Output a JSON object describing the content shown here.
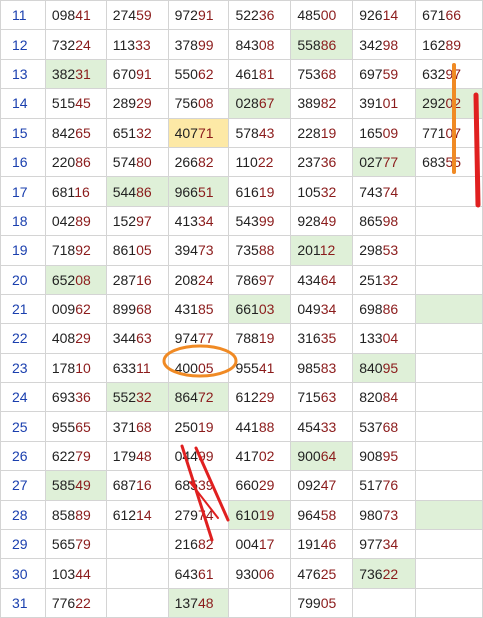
{
  "rows": [
    {
      "num": "11",
      "cells": [
        {
          "v": "09841"
        },
        {
          "v": "27459"
        },
        {
          "v": "97291"
        },
        {
          "v": "52236"
        },
        {
          "v": "48500"
        },
        {
          "v": "92614"
        },
        {
          "v": "67166"
        }
      ]
    },
    {
      "num": "12",
      "cells": [
        {
          "v": "73224"
        },
        {
          "v": "11333"
        },
        {
          "v": "37899"
        },
        {
          "v": "84308"
        },
        {
          "v": "55886",
          "hl": "green"
        },
        {
          "v": "34298"
        },
        {
          "v": "16289"
        }
      ]
    },
    {
      "num": "13",
      "cells": [
        {
          "v": "38231",
          "hl": "green"
        },
        {
          "v": "67091"
        },
        {
          "v": "55062"
        },
        {
          "v": "46181"
        },
        {
          "v": "75368"
        },
        {
          "v": "69759"
        },
        {
          "v": "63297"
        }
      ]
    },
    {
      "num": "14",
      "cells": [
        {
          "v": "51545"
        },
        {
          "v": "28929"
        },
        {
          "v": "75608"
        },
        {
          "v": "02867",
          "hl": "green"
        },
        {
          "v": "38982"
        },
        {
          "v": "39101"
        },
        {
          "v": "29202",
          "hl": "green"
        }
      ]
    },
    {
      "num": "15",
      "cells": [
        {
          "v": "84265"
        },
        {
          "v": "65132"
        },
        {
          "v": "40771",
          "hl": "yellow"
        },
        {
          "v": "57843"
        },
        {
          "v": "22819"
        },
        {
          "v": "16509"
        },
        {
          "v": "77107"
        }
      ]
    },
    {
      "num": "16",
      "cells": [
        {
          "v": "22086"
        },
        {
          "v": "57480"
        },
        {
          "v": "26682"
        },
        {
          "v": "11022"
        },
        {
          "v": "23736"
        },
        {
          "v": "02777",
          "hl": "green"
        },
        {
          "v": "68355"
        }
      ]
    },
    {
      "num": "17",
      "cells": [
        {
          "v": "68116"
        },
        {
          "v": "54486",
          "hl": "green"
        },
        {
          "v": "96651",
          "hl": "green"
        },
        {
          "v": "61619"
        },
        {
          "v": "10532"
        },
        {
          "v": "74374"
        },
        {
          "v": ""
        }
      ]
    },
    {
      "num": "18",
      "cells": [
        {
          "v": "04289"
        },
        {
          "v": "15297"
        },
        {
          "v": "41334"
        },
        {
          "v": "54399"
        },
        {
          "v": "92849"
        },
        {
          "v": "86598"
        },
        {
          "v": ""
        }
      ]
    },
    {
      "num": "19",
      "cells": [
        {
          "v": "71892"
        },
        {
          "v": "86105"
        },
        {
          "v": "39473"
        },
        {
          "v": "73588"
        },
        {
          "v": "20112",
          "hl": "green"
        },
        {
          "v": "29853"
        },
        {
          "v": ""
        }
      ]
    },
    {
      "num": "20",
      "cells": [
        {
          "v": "65208",
          "hl": "green"
        },
        {
          "v": "28716"
        },
        {
          "v": "20824"
        },
        {
          "v": "78697"
        },
        {
          "v": "43464"
        },
        {
          "v": "25132"
        },
        {
          "v": ""
        }
      ]
    },
    {
      "num": "21",
      "cells": [
        {
          "v": "00962"
        },
        {
          "v": "89968"
        },
        {
          "v": "43185"
        },
        {
          "v": "66103",
          "hl": "green"
        },
        {
          "v": "04934"
        },
        {
          "v": "69886"
        },
        {
          "v": "",
          "hl": "green"
        }
      ]
    },
    {
      "num": "22",
      "cells": [
        {
          "v": "40829"
        },
        {
          "v": "34463"
        },
        {
          "v": "97477"
        },
        {
          "v": "78819"
        },
        {
          "v": "31635"
        },
        {
          "v": "13304"
        },
        {
          "v": ""
        }
      ]
    },
    {
      "num": "23",
      "cells": [
        {
          "v": "17810"
        },
        {
          "v": "63311"
        },
        {
          "v": "40005"
        },
        {
          "v": "95541"
        },
        {
          "v": "98583"
        },
        {
          "v": "84095",
          "hl": "green"
        },
        {
          "v": ""
        }
      ]
    },
    {
      "num": "24",
      "cells": [
        {
          "v": "69336"
        },
        {
          "v": "55232",
          "hl": "green"
        },
        {
          "v": "86472",
          "hl": "green"
        },
        {
          "v": "61229"
        },
        {
          "v": "71563"
        },
        {
          "v": "82084"
        },
        {
          "v": ""
        }
      ]
    },
    {
      "num": "25",
      "cells": [
        {
          "v": "95565"
        },
        {
          "v": "37168"
        },
        {
          "v": "25019"
        },
        {
          "v": "44188"
        },
        {
          "v": "45433"
        },
        {
          "v": "53768"
        },
        {
          "v": ""
        }
      ]
    },
    {
      "num": "26",
      "cells": [
        {
          "v": "62279"
        },
        {
          "v": "17948"
        },
        {
          "v": "04499"
        },
        {
          "v": "41702"
        },
        {
          "v": "90064",
          "hl": "green"
        },
        {
          "v": "90895"
        },
        {
          "v": ""
        }
      ]
    },
    {
      "num": "27",
      "cells": [
        {
          "v": "58549",
          "hl": "green"
        },
        {
          "v": "68716"
        },
        {
          "v": "68539"
        },
        {
          "v": "66029"
        },
        {
          "v": "09247"
        },
        {
          "v": "51776"
        },
        {
          "v": ""
        }
      ]
    },
    {
      "num": "28",
      "cells": [
        {
          "v": "85889"
        },
        {
          "v": "61214"
        },
        {
          "v": "27974"
        },
        {
          "v": "61019",
          "hl": "green"
        },
        {
          "v": "96458"
        },
        {
          "v": "98073"
        },
        {
          "v": "",
          "hl": "green"
        }
      ]
    },
    {
      "num": "29",
      "cells": [
        {
          "v": "56579"
        },
        {
          "v": ""
        },
        {
          "v": "21682"
        },
        {
          "v": "00417"
        },
        {
          "v": "19146"
        },
        {
          "v": "97734"
        },
        {
          "v": ""
        }
      ]
    },
    {
      "num": "30",
      "cells": [
        {
          "v": "10344"
        },
        {
          "v": ""
        },
        {
          "v": "64361"
        },
        {
          "v": "93006"
        },
        {
          "v": "47625"
        },
        {
          "v": "73622",
          "hl": "green"
        },
        {
          "v": ""
        }
      ]
    },
    {
      "num": "31",
      "cells": [
        {
          "v": "77622"
        },
        {
          "v": ""
        },
        {
          "v": "13748",
          "hl": "green"
        },
        {
          "v": ""
        },
        {
          "v": "79905"
        },
        {
          "v": ""
        },
        {
          "v": ""
        }
      ]
    }
  ],
  "colors": {
    "row_number": "#1a3fae",
    "green_highlight": "#dff0d8",
    "yellow_highlight": "#fde9a6",
    "suffix_digits": "#8b1b1b",
    "orange_annotation": "#f08a24",
    "red_annotation": "#e02020"
  }
}
